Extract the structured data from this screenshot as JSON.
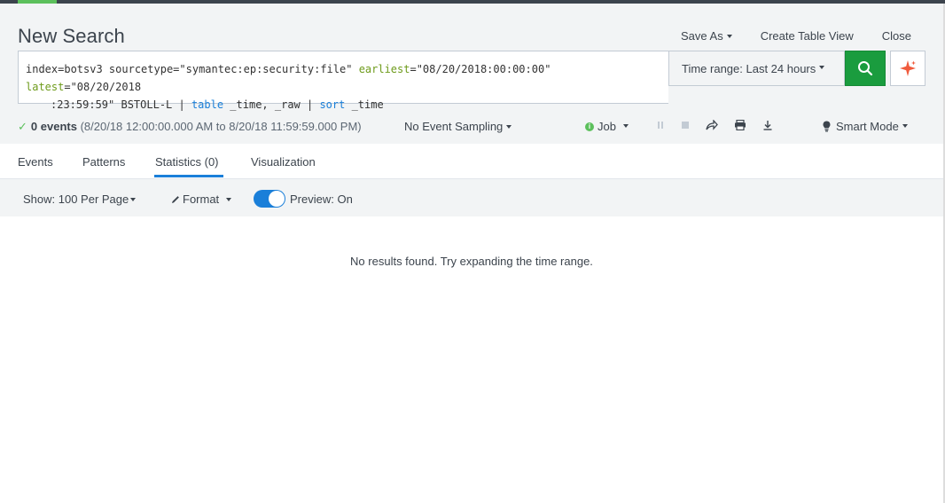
{
  "page": {
    "title": "New Search"
  },
  "top_actions": {
    "save_as": "Save As",
    "create_table_view": "Create Table View",
    "close": "Close"
  },
  "search": {
    "line1": {
      "p1": "index=botsv3 sourcetype=\"symantec:ep:security:file\" ",
      "kw_earliest": "earliest",
      "p2": "=\"08/20/2018:00:00:00\" ",
      "kw_latest": "latest",
      "p3": "=\"08/20/2018"
    },
    "line2": {
      "p1": ":23:59:59\" BSTOLL-L | ",
      "cmd_table": "table",
      "p2": " _time, _raw | ",
      "cmd_sort": "sort",
      "p3": " _time"
    },
    "time_range": "Time range: Last 24 hours",
    "search_icon": "search-icon",
    "assist_icon": "sparkle-icon"
  },
  "status": {
    "event_count": "0 events",
    "range_text": "(8/20/18 12:00:00.000 AM to 8/20/18 11:59:59.000 PM)",
    "sampling": "No Event Sampling",
    "job": "Job",
    "mode": "Smart Mode"
  },
  "tabs": [
    {
      "label": "Events"
    },
    {
      "label": "Patterns"
    },
    {
      "label": "Statistics (0)"
    },
    {
      "label": "Visualization"
    }
  ],
  "toolbar": {
    "show": "Show: 100 Per Page",
    "format": "Format",
    "preview": "Preview: On"
  },
  "results": {
    "message": "No results found. Try expanding the time range."
  },
  "colors": {
    "accent_green": "#5cc05c",
    "search_button": "#1a9c3e",
    "link_blue": "#1a7fd9",
    "keyword_green": "#6e9b1b",
    "assist_icon": "#f05a3c"
  }
}
